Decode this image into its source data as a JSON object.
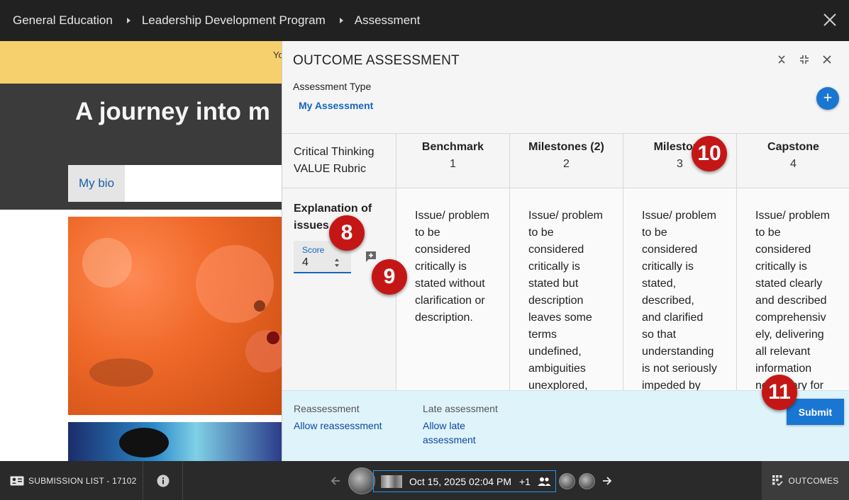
{
  "breadcrumb": [
    "General Education",
    "Leadership Development Program",
    "Assessment"
  ],
  "notice_text": "Yo",
  "page": {
    "title": "A journey into m",
    "tab_label": "My bio"
  },
  "panel": {
    "title": "OUTCOME ASSESSMENT",
    "assessment_type_label": "Assessment Type",
    "assessment_type_value": "My Assessment",
    "add_icon": "+",
    "rubric": {
      "name_line1": "Critical Thinking",
      "name_line2": "VALUE Rubric",
      "levels": [
        {
          "name": "Benchmark",
          "score": "1"
        },
        {
          "name": "Milestones (2)",
          "score": "2"
        },
        {
          "name": "Milestone",
          "score": "3"
        },
        {
          "name": "Capstone",
          "score": "4"
        }
      ],
      "criterion": {
        "name_line1": "Explanation of",
        "name_line2": "issues",
        "score_label": "Score",
        "score_value": "4",
        "descriptions": [
          [
            "Issue/ problem",
            "to be",
            "considered",
            "critically is",
            "stated without",
            "clarification or",
            "description."
          ],
          [
            "Issue/ problem",
            "to be",
            "considered",
            "critically is",
            "stated but",
            "description",
            "leaves some",
            "terms",
            "undefined,",
            "ambiguities",
            "unexplored,"
          ],
          [
            "Issue/ problem",
            "to be",
            "considered",
            "critically is",
            "stated,",
            "described,",
            "and clarified",
            "so that",
            "understanding",
            "is not seriously",
            "impeded by"
          ],
          [
            "Issue/ problem",
            "to be",
            "considered",
            "critically is",
            "stated clearly",
            "and described",
            "comprehensiv",
            "ely, delivering",
            "all relevant",
            "information",
            "necessary for"
          ]
        ]
      }
    },
    "footer": {
      "reassessment_label": "Reassessment",
      "reassessment_link": "Allow reassessment",
      "late_label": "Late assessment",
      "late_link_line1": "Allow late",
      "late_link_line2": "assessment",
      "submit_label": "Submit"
    }
  },
  "badges": [
    "8",
    "9",
    "10",
    "11"
  ],
  "bottom": {
    "submission_list": "SUBMISSION LIST - 17102",
    "date": "Oct 15, 2025 02:04 PM",
    "extra_count": "+1",
    "outcomes": "OUTCOMES"
  },
  "colors": {
    "accent": "#1976d2",
    "badge": "#c51616",
    "notice": "#f6d06c",
    "footer_bg": "#dff3fb"
  },
  "icons": [
    "close-icon",
    "collapse-icon",
    "shrink-icon",
    "add-icon",
    "comment-add-icon",
    "id-card-icon",
    "info-icon",
    "arrow-left-icon",
    "arrow-right-icon",
    "people-icon",
    "outcomes-grid-icon"
  ]
}
